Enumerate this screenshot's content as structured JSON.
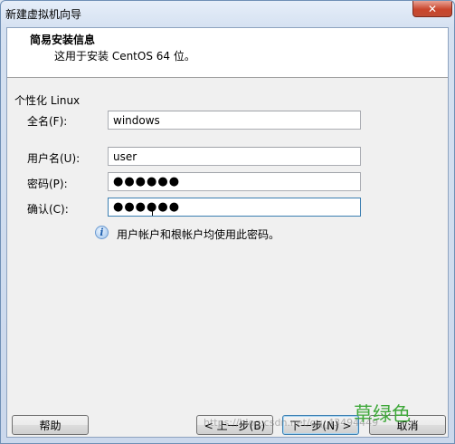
{
  "window": {
    "title": "新建虚拟机向导",
    "close_icon": "close-icon"
  },
  "header": {
    "title": "简易安装信息",
    "subtitle": "这用于安装 CentOS 64 位。"
  },
  "form": {
    "group_label": "个性化 Linux",
    "full_name": {
      "label": "全名(F):",
      "value": "windows"
    },
    "username": {
      "label": "用户名(U):",
      "value": "user"
    },
    "password": {
      "label": "密码(P):",
      "value": "●●●●●●"
    },
    "confirm": {
      "label": "确认(C):",
      "value": "●●●●●●"
    }
  },
  "info": {
    "icon": "info-icon",
    "text": "用户帐户和根帐户均使用此密码。"
  },
  "buttons": {
    "help": "帮助",
    "back": "< 上一步(B)",
    "next": "下一步(N) >",
    "cancel": "取消"
  },
  "watermark": "https://blog.csdn.net/qq_43494449",
  "brand": "草绿色"
}
